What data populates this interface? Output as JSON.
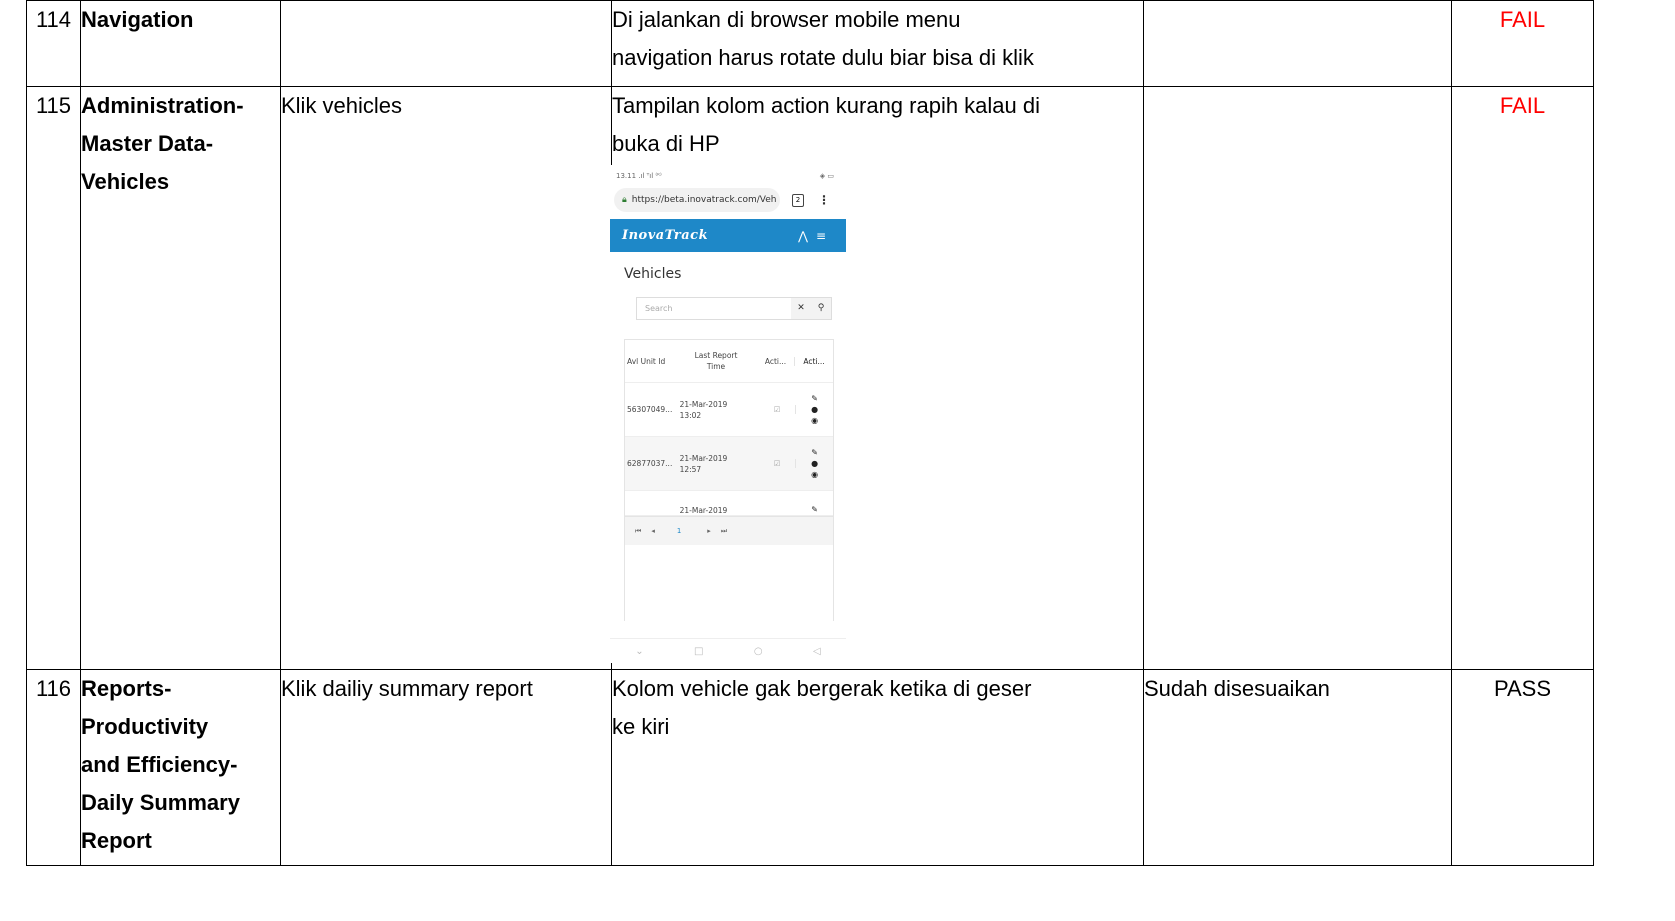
{
  "rows": [
    {
      "no": "114",
      "module": "Navigation",
      "step": "",
      "result_lines": [
        "Di jalankan di browser mobile menu",
        "navigation harus rotate dulu biar bisa di klik"
      ],
      "fix": "",
      "status": "FAIL"
    },
    {
      "no": "115",
      "module_lines": [
        "Administration-",
        "Master Data-",
        "Vehicles"
      ],
      "step": "Klik vehicles",
      "result_lines": [
        "Tampilan kolom action kurang rapih kalau di",
        "buka di HP"
      ],
      "fix": "",
      "status": "FAIL"
    },
    {
      "no": "116",
      "module_lines": [
        "Reports-",
        "Productivity",
        "and Efficiency-",
        "Daily Summary",
        "Report"
      ],
      "step": "Klik dailiy summary report",
      "result_lines": [
        "Kolom vehicle gak bergerak ketika di geser",
        "ke kiri"
      ],
      "fix": "Sudah disesuaikan",
      "status": "PASS"
    }
  ],
  "screenshot": {
    "status_left": "13.11 .ıl ᵀıl ⁽ᴷ⁾",
    "status_right": "◈ ▭",
    "url": "https://beta.inovatrack.com/Veh",
    "tab_count": "2",
    "app_name": "InovaTrack",
    "page_title": "Vehicles",
    "search_placeholder": "Search",
    "col_unit": "Avl Unit Id",
    "col_last_1": "Last Report",
    "col_last_2": "Time",
    "col_active": "Acti...",
    "col_action": "Acti...",
    "r1_unit": "56307049...",
    "r1_date": "21-Mar-2019",
    "r1_time": "13:02",
    "r2_unit": "62877037...",
    "r2_date": "21-Mar-2019",
    "r2_time": "12:57",
    "r3_date": "21-Mar-2019",
    "page_number": "1"
  },
  "colors": {
    "fail": "#ff0000",
    "appbar": "#1e88c8"
  }
}
